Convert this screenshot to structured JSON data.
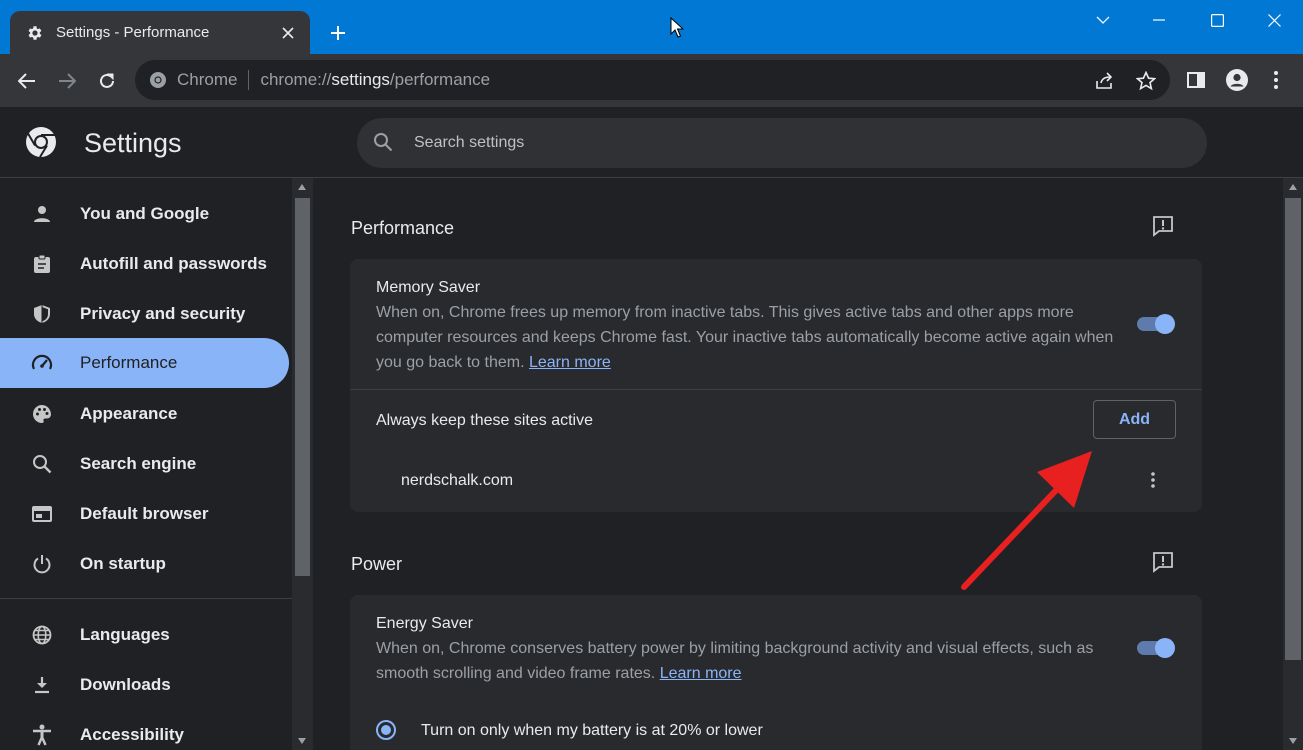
{
  "browser": {
    "tab_title": "Settings - Performance",
    "omnibox_chip": "Chrome",
    "url_scheme": "chrome://",
    "url_host": "settings",
    "url_path": "/performance"
  },
  "header": {
    "title": "Settings",
    "search_placeholder": "Search settings"
  },
  "sidebar": {
    "items": [
      {
        "label": "You and Google",
        "icon": "person-icon"
      },
      {
        "label": "Autofill and passwords",
        "icon": "clipboard-icon"
      },
      {
        "label": "Privacy and security",
        "icon": "shield-icon"
      },
      {
        "label": "Performance",
        "icon": "speedometer-icon",
        "active": true
      },
      {
        "label": "Appearance",
        "icon": "palette-icon"
      },
      {
        "label": "Search engine",
        "icon": "search-icon"
      },
      {
        "label": "Default browser",
        "icon": "browser-window-icon"
      },
      {
        "label": "On startup",
        "icon": "power-icon"
      },
      {
        "label": "Languages",
        "icon": "globe-icon"
      },
      {
        "label": "Downloads",
        "icon": "download-icon"
      },
      {
        "label": "Accessibility",
        "icon": "accessibility-icon"
      }
    ]
  },
  "performance": {
    "section_title": "Performance",
    "memory_saver": {
      "title": "Memory Saver",
      "description": "When on, Chrome frees up memory from inactive tabs. This gives active tabs and other apps more computer resources and keeps Chrome fast. Your inactive tabs automatically become active again when you go back to them.",
      "learn_more": "Learn more",
      "enabled": true
    },
    "always_active": {
      "label": "Always keep these sites active",
      "add_button": "Add",
      "sites": [
        "nerdschalk.com"
      ]
    }
  },
  "power": {
    "section_title": "Power",
    "energy_saver": {
      "title": "Energy Saver",
      "description": "When on, Chrome conserves battery power by limiting background activity and visual effects, such as smooth scrolling and video frame rates.",
      "learn_more": "Learn more",
      "enabled": true
    },
    "options": [
      {
        "label": "Turn on only when my battery is at 20% or lower",
        "selected": true
      }
    ]
  },
  "colors": {
    "titlebar": "#0078d4",
    "accent": "#8ab4f8",
    "background": "#202124",
    "card": "#292a2d",
    "annotation_arrow": "#e8201f"
  }
}
